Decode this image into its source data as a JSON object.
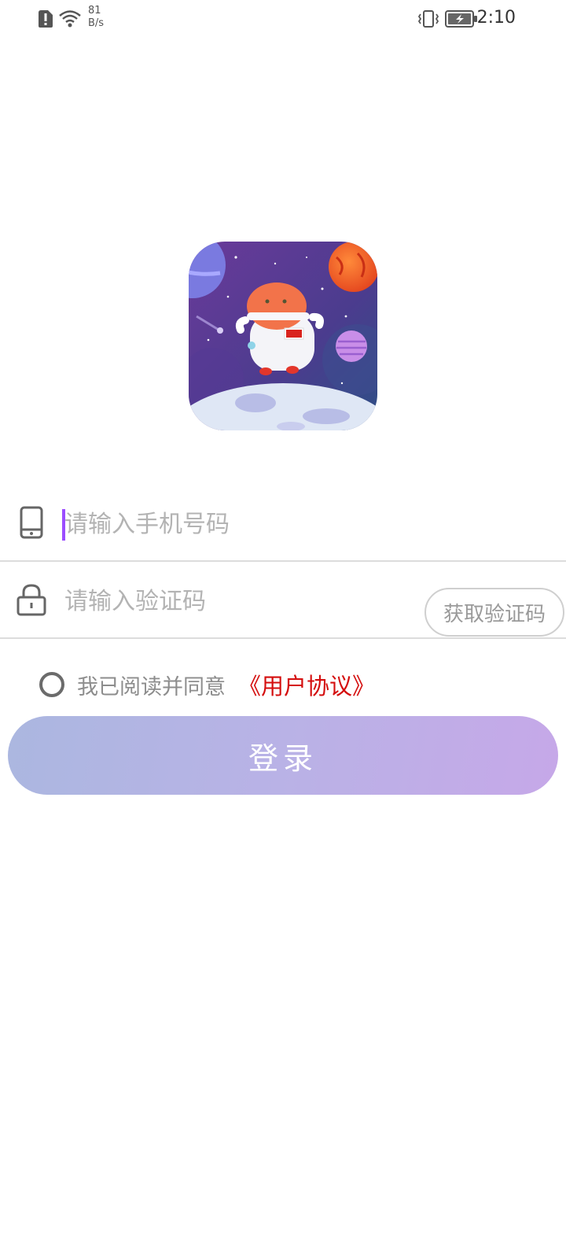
{
  "status_bar": {
    "net_speed_value": "81",
    "net_speed_unit": "B/s",
    "time": "2:10"
  },
  "login_form": {
    "phone_placeholder": "请输入手机号码",
    "code_placeholder": "请输入验证码",
    "get_code_label": "获取验证码",
    "agreement_text": "我已阅读并同意",
    "agreement_link": "《用户协议》",
    "login_label": "登录"
  },
  "icons": {
    "phone": "mobile-phone-icon",
    "lock": "lock-icon"
  },
  "colors": {
    "link": "#d40e0e",
    "caret": "#9b4dff",
    "button_gradient_start": "#abb7e0",
    "button_gradient_end": "#c6a8e8"
  }
}
